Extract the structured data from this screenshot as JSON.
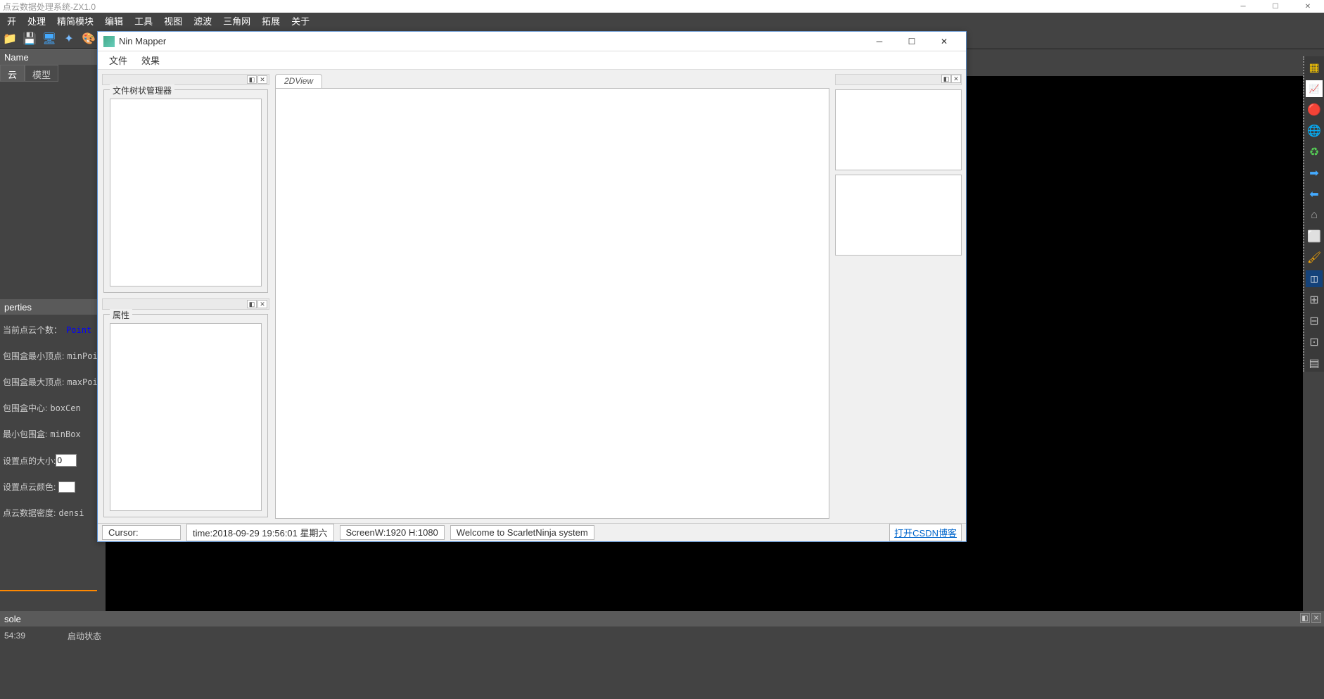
{
  "bg": {
    "title": "点云数据处理系统-ZX1.0",
    "menus": [
      "开",
      "处理",
      "精简模块",
      "编辑",
      "工具",
      "视图",
      "滤波",
      "三角网",
      "拓展",
      "关于"
    ],
    "name_header": "Name",
    "tabs": {
      "cloud": "云",
      "model": "模型"
    },
    "props_header": "perties",
    "props": {
      "count_label": "当前点云个数：",
      "count_val": "Point",
      "min_label": "包围盒最小顶点:",
      "min_val": "minPoi",
      "max_label": "包围盒最大顶点:",
      "max_val": "maxPoi",
      "center_label": "包围盒中心:",
      "center_val": "boxCen",
      "minbox_label": "最小包围盒:",
      "minbox_val": "minBox",
      "size_label": "设置点的大小:",
      "size_val": "0",
      "color_label": "设置点云颜色:",
      "density_label": "点云数据密度:",
      "density_val": "densi"
    },
    "console_header": "sole",
    "console_time": "54:39",
    "console_status": "启动状态"
  },
  "nm": {
    "title": "Nin Mapper",
    "menus": [
      "文件",
      "效果"
    ],
    "left_panel1_title": "文件树状管理器",
    "left_panel2_title": "属性",
    "center_tab": "2DView",
    "status": {
      "cursor": "Cursor:",
      "time": "time:2018-09-29 19:56:01 星期六",
      "screen": "ScreenW:1920 H:1080",
      "welcome": "Welcome to ScarletNinja system",
      "link": "打开CSDN博客"
    }
  }
}
